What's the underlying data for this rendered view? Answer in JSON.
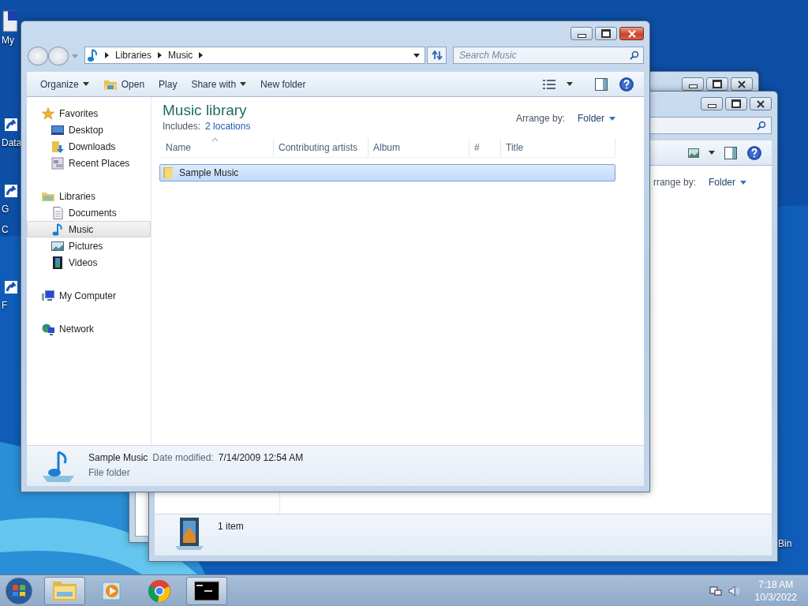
{
  "desktop_icons": [
    {
      "label": "My",
      "kind": "computer"
    },
    {
      "label": "Data",
      "kind": "shortcut"
    },
    {
      "label": "G",
      "kind": "shortcut"
    },
    {
      "label": "C",
      "kind": "text"
    },
    {
      "label": "F",
      "kind": "shortcut"
    },
    {
      "label": "Bin",
      "kind": "text"
    }
  ],
  "back_window": {
    "arrange_label": "rrange by:",
    "arrange_value": "Folder",
    "status": "1 item"
  },
  "window": {
    "path": [
      "Libraries",
      "Music"
    ],
    "search_placeholder": "Search Music",
    "toolbar": [
      {
        "label": "Organize",
        "dropdown": true,
        "icon": false
      },
      {
        "label": "Open",
        "dropdown": false,
        "icon": true
      },
      {
        "label": "Play",
        "dropdown": false,
        "icon": false
      },
      {
        "label": "Share with",
        "dropdown": true,
        "icon": false
      },
      {
        "label": "New folder",
        "dropdown": false,
        "icon": false
      }
    ],
    "nav": [
      {
        "label": "Favorites",
        "kind": "star",
        "selected": false,
        "children": [
          {
            "label": "Desktop",
            "kind": "desktop",
            "selected": false
          },
          {
            "label": "Downloads",
            "kind": "downloads",
            "selected": false
          },
          {
            "label": "Recent Places",
            "kind": "recent",
            "selected": false
          }
        ]
      },
      {
        "label": "Libraries",
        "kind": "library",
        "selected": false,
        "children": [
          {
            "label": "Documents",
            "kind": "document",
            "selected": false
          },
          {
            "label": "Music",
            "kind": "music",
            "selected": true
          },
          {
            "label": "Pictures",
            "kind": "pictures",
            "selected": false
          },
          {
            "label": "Videos",
            "kind": "videos",
            "selected": false
          }
        ]
      },
      {
        "label": "My Computer",
        "kind": "computer",
        "selected": false
      },
      {
        "label": "Network",
        "kind": "network",
        "selected": false
      }
    ],
    "library_title": "Music library",
    "includes_label": "Includes:",
    "includes_link": "2 locations",
    "arrange_label": "Arrange by:",
    "arrange_value": "Folder",
    "columns": [
      "Name",
      "Contributing artists",
      "Album",
      "#",
      "Title"
    ],
    "rows": [
      {
        "name": "Sample Music",
        "selected": true
      }
    ],
    "details": {
      "name": "Sample Music",
      "type": "File folder",
      "date_label": "Date modified:",
      "date_value": "7/14/2009 12:54 AM"
    }
  },
  "taskbar": {
    "items": [
      {
        "kind": "explorer",
        "running": true
      },
      {
        "kind": "media",
        "running": false
      },
      {
        "kind": "browser",
        "running": false
      },
      {
        "kind": "terminal",
        "running": true
      }
    ],
    "time": "7:18 AM",
    "date": "10/3/2022"
  }
}
